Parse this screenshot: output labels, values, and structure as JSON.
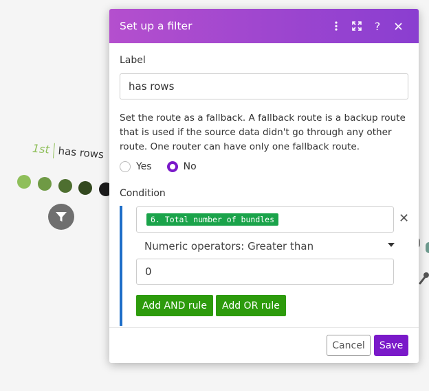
{
  "canvas": {
    "route_order": "1st",
    "route_name": "has rows",
    "dot_colors": [
      "#8fbf5a",
      "#6f9a45",
      "#4e6f30",
      "#33491f",
      "#1c1c1c"
    ]
  },
  "dialog": {
    "title": "Set up a filter",
    "header_icons": [
      "more-vertical-icon",
      "expand-icon",
      "help-icon",
      "close-icon"
    ],
    "label_heading": "Label",
    "label_value": "has rows",
    "fallback_help": "Set the route as a fallback. A fallback route is a backup route that is used if the source data didn't go through any other route. One router can have only one fallback route.",
    "fallback_options": [
      {
        "label": "Yes",
        "checked": false
      },
      {
        "label": "No",
        "checked": true
      }
    ],
    "condition_heading": "Condition",
    "condition": {
      "field_pill": "6. Total number of bundles",
      "operator": "Numeric operators: Greater than",
      "value": "0"
    },
    "add_and_label": "Add AND rule",
    "add_or_label": "Add OR rule",
    "cancel_label": "Cancel",
    "save_label": "Save",
    "accent_color": "#7a19c9",
    "header_gradient": [
      "#b44fce",
      "#8a3ed0"
    ],
    "condition_bar_color": "#1e6ec8",
    "button_green": "#2d9b0c"
  }
}
